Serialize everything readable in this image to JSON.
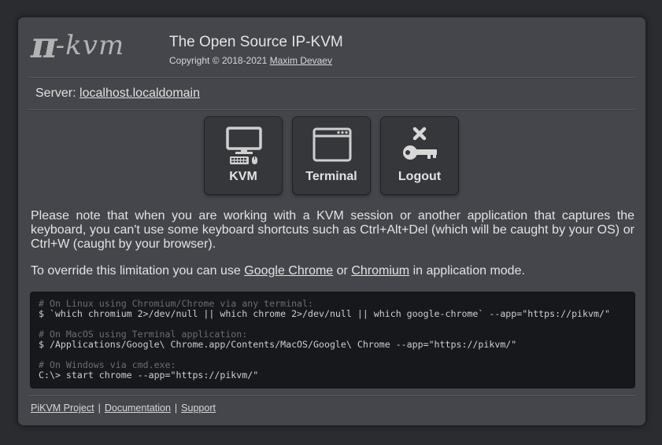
{
  "header": {
    "logo_pi": "π",
    "logo_kvm": "-kvm",
    "title": "The Open Source IP-KVM",
    "copyright_prefix": "Copyright © 2018-2021",
    "copyright_author": "Maxim Devaev"
  },
  "server": {
    "label": "Server:",
    "host": "localhost.localdomain"
  },
  "tiles": [
    {
      "label": "KVM",
      "icon": "monitor-keyboard-icon"
    },
    {
      "label": "Terminal",
      "icon": "terminal-window-icon"
    },
    {
      "label": "Logout",
      "icon": "key-cross-icon"
    }
  ],
  "note": {
    "paragraph1": "Please note that when you are working with a KVM session or another application that captures the keyboard, you can't use some keyboard shortcuts such as Ctrl+Alt+Del (which will be caught by your OS) or Ctrl+W (caught by your browser).",
    "p2_prefix": "To override this limitation you can use",
    "p2_link1": "Google Chrome",
    "p2_or": "or",
    "p2_link2": "Chromium",
    "p2_suffix": "in application mode."
  },
  "code": {
    "linux_comment": "# On Linux using Chromium/Chrome via any terminal:",
    "linux_command": "$ `which chromium 2>/dev/null || which chrome 2>/dev/null || which google-chrome` --app=\"https://pikvm/\"",
    "macos_comment": "# On MacOS using Terminal application:",
    "macos_command": "$ /Applications/Google\\ Chrome.app/Contents/MacOS/Google\\ Chrome --app=\"https://pikvm/\"",
    "windows_comment": "# On Windows via cmd.exe:",
    "windows_command": "C:\\> start chrome --app=\"https://pikvm/\""
  },
  "footer": {
    "link1": "PiKVM Project",
    "sep": "|",
    "link2": "Documentation",
    "link3": "Support"
  },
  "colors": {
    "page_bg": "#2b2c30",
    "panel_bg": "#45464b",
    "tile_bg": "#36373b",
    "code_bg": "#17181b",
    "comment": "#6b6d72"
  }
}
